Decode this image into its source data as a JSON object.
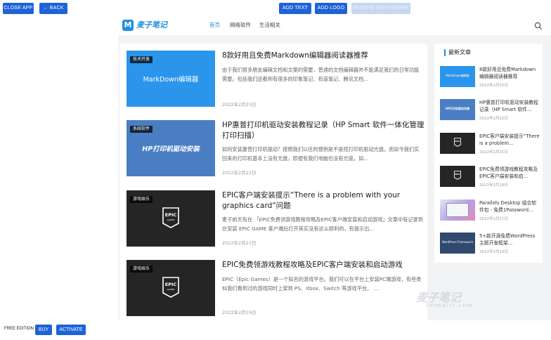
{
  "toolbar": {
    "close_app": "CLOSE APP",
    "back": "BACK",
    "add_text": "ADD TEXT",
    "add_logo": "ADD LOGO",
    "remove_watermark": "REMOVE WATERMARK"
  },
  "site": {
    "logo_letter": "M",
    "logo_text": "麦子笔记",
    "nav": [
      "首页",
      "网络软件",
      "生活相关"
    ]
  },
  "articles": [
    {
      "tag": "技术开发",
      "thumb_text": "MarkDown编辑器",
      "title": "8款好用且免费Markdown编辑器阅读器推荐",
      "excerpt": "由于我们很多朋友编辑文档和文案的需要，普通的文档编辑器并不能满足我们的日常功能需要。包括我们还看到有很多的印象笔记、有道笔记、腾讯文档...",
      "date": "2022年2月25日"
    },
    {
      "tag": "系统软件",
      "thumb_text": "HP打印机驱动安装",
      "title": "HP惠普打印机驱动安装教程记录（HP Smart 软件一体化管理打印扫描）",
      "excerpt": "如何安装惠普打印机驱动？按照我们以往的惯例是不是找打印机驱动光盘。而如今我们买回来的打印机基本上没有光盘，即便有我们电脑也没有光驱。如...",
      "date": "2022年2月22日"
    },
    {
      "tag": "游戏娱乐",
      "thumb_text": "EPIC GAMES",
      "title": "EPIC客户端安装提示“There is a problem with your graphics card”问题",
      "excerpt": "麦子前天有在 「EPIC免费领游戏教程攻略及EPIC客户端安装和启动游戏」文章中有记录到在安装 EPIC GAME 客户端后打开其实没有这么顺利的，有提示出...",
      "date": "2022年2月21日"
    },
    {
      "tag": "游戏娱乐",
      "thumb_text": "EPIC GAMES",
      "title": "EPIC免费领游戏教程攻略及EPIC客户端安装和启动游戏",
      "excerpt": "EPIC（Epic Games）是一个知名的游戏平台。我们可以在平台上安装PC端游戏，有些类似我们看到过的游戏同时上架到 PS、Xbox、Switch 等游戏平台。 ...",
      "date": "2022年2月19日"
    }
  ],
  "sidebar": {
    "heading": "最新文章",
    "items": [
      {
        "thumb_text": "MarkDown编辑器",
        "title": "8款好用且免费Markdown编辑器阅读器推荐",
        "date": "2022年2月25日"
      },
      {
        "thumb_text": "HP打印机驱动安装",
        "title": "HP惠普打印机驱动安装教程记录（HP Smart 软件...",
        "date": "2022年2月22日"
      },
      {
        "thumb_text": "EPIC GAMES",
        "title": "EPIC客户端安装提示“There is a problem...",
        "date": "2022年2月21日"
      },
      {
        "thumb_text": "EPIC GAMES",
        "title": "EPIC免费领游戏教程攻略及EPIC客户端安装和启...",
        "date": "2022年2月19日"
      },
      {
        "thumb_text": "",
        "title": "Parallels Desktop 组合软件包 - 免费1Password...",
        "date": "2022年2月17日"
      },
      {
        "thumb_text": "WordPress Framework",
        "title": "5+款开源免费WordPress主题开发框架...",
        "date": "2022年2月13日"
      }
    ]
  },
  "watermark": {
    "big": "麦子笔记",
    "small": "immaizi.com"
  },
  "bottom": {
    "edition": "FREE EDITION",
    "buy": "BUY",
    "activate": "ACTIVATE"
  },
  "colors": {
    "primary_button": "#1e63d6",
    "brand": "#1e8fe0"
  }
}
